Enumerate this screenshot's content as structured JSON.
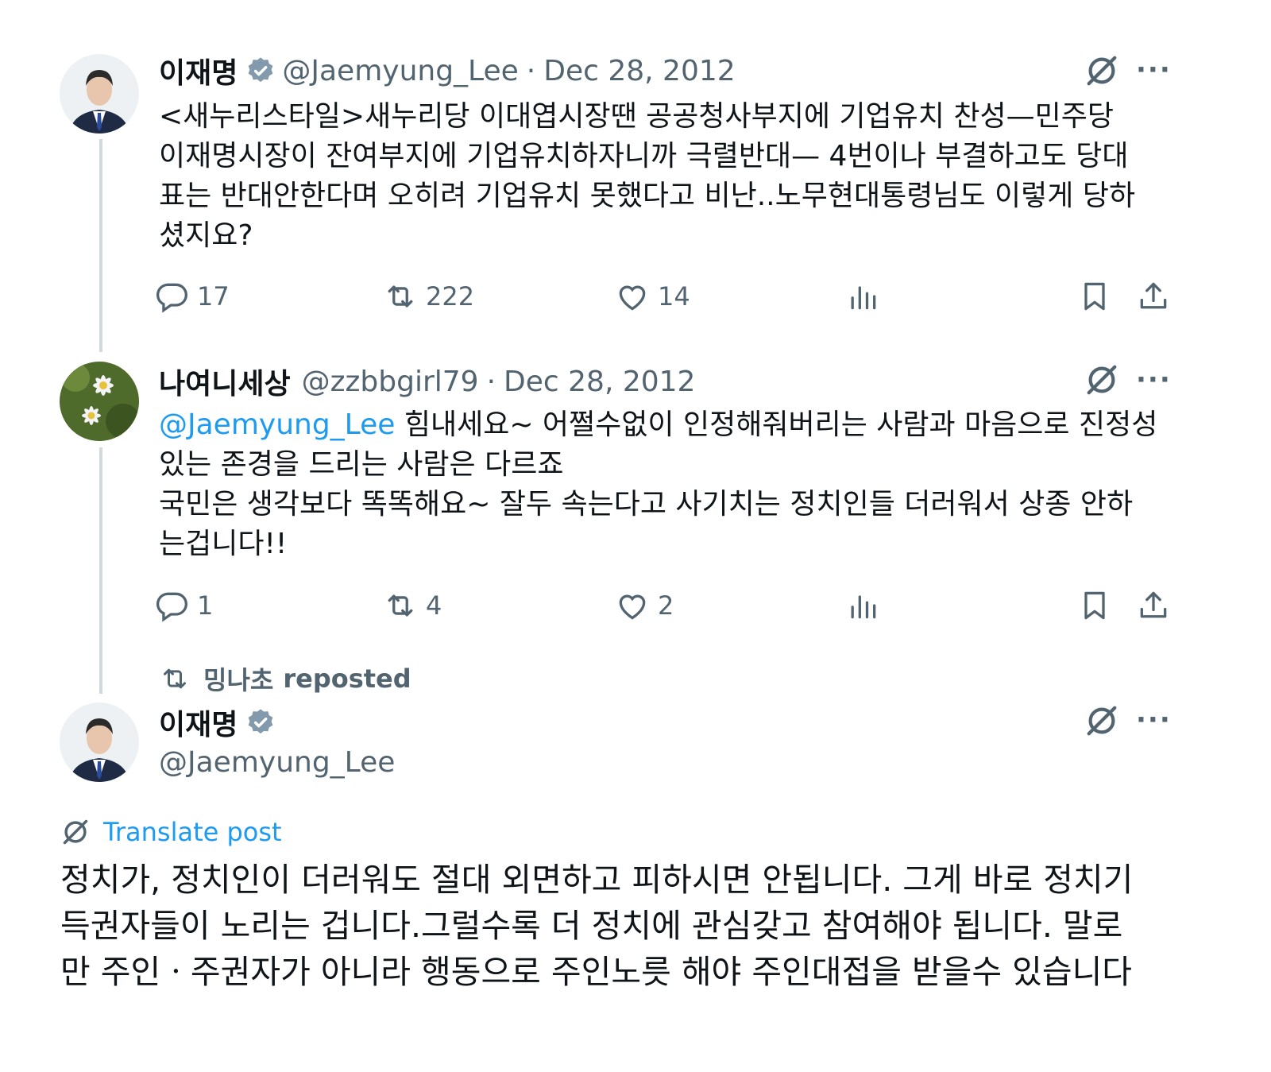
{
  "colors": {
    "link": "#1d9bf0",
    "muted": "#536471",
    "text": "#0f1419",
    "verified": "#829aab"
  },
  "posts": [
    {
      "name": "이재명",
      "verified": true,
      "handle": "@Jaemyung_Lee",
      "sep": "·",
      "date": "Dec 28, 2012",
      "text": "<새누리스타일>새누리당 이대엽시장땐 공공청사부지에 기업유치 찬성—민주당\n이재명시장이 잔여부지에 기업유치하자니까 극렬반대— 4번이나 부결하고도 당대\n표는 반대안한다며 오히려 기업유치 못했다고 비난..노무현대통령님도 이렇게 당하\n셨지요?",
      "replies": "17",
      "reposts": "222",
      "likes": "14"
    },
    {
      "name": "나여니세상",
      "handle": "@zzbbgirl79",
      "sep": "·",
      "date": "Dec 28, 2012",
      "mention": "@Jaemyung_Lee",
      "text": " 힘내세요~ 어쩔수없이 인정해줘버리는 사람과 마음으로 진정성\n있는 존경을 드리는 사람은 다르죠\n국민은 생각보다 똑똑해요~ 잘두 속는다고 사기치는 정치인들 더러워서 상종 안하\n는겁니다!!",
      "replies": "1",
      "reposts": "4",
      "likes": "2"
    }
  ],
  "repost_notice": {
    "user": "밍나초",
    "label": "reposted"
  },
  "main_post": {
    "name": "이재명",
    "verified": true,
    "handle": "@Jaemyung_Lee",
    "translate_label": "Translate post",
    "text": "정치가, 정치인이 더러워도 절대 외면하고  피하시면 안됩니다. 그게 바로 정치기\n득권자들이 노리는 겁니다.그럴수록 더 정치에 관심갖고 참여해야 됩니다. 말로\n만 주인ㆍ주권자가 아니라 행동으로 주인노릇 해야 주인대접을 받을수 있습니다"
  },
  "icons": {
    "more": "more-icon",
    "translate": "translate-icon",
    "reply": "reply-icon",
    "repost": "repost-icon",
    "like": "like-icon",
    "views": "views-icon",
    "bookmark": "bookmark-icon",
    "share": "share-icon"
  },
  "more_glyph": "···"
}
